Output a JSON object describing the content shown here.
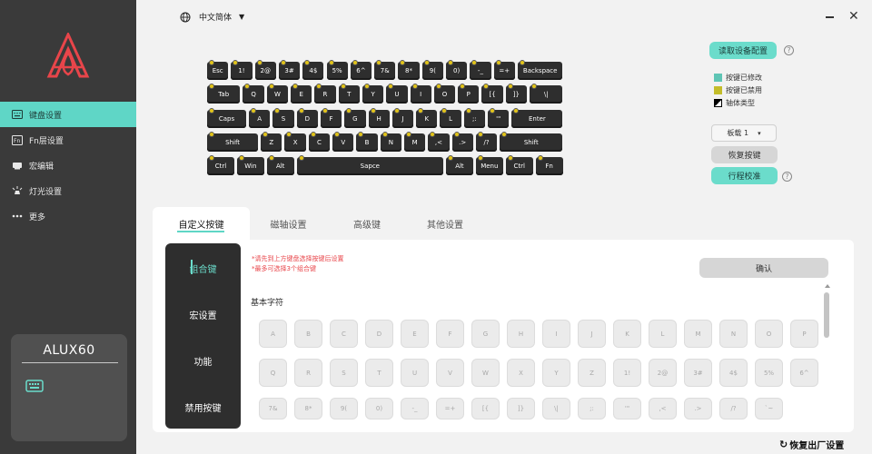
{
  "app": {
    "language": "中文简体",
    "device_name": "ALUX60"
  },
  "sidebar": {
    "items": [
      {
        "label": "键盘设置",
        "icon": "keyboard-icon",
        "active": true
      },
      {
        "label": "Fn层设置",
        "icon": "fn-icon",
        "active": false
      },
      {
        "label": "宏编辑",
        "icon": "macro-icon",
        "active": false
      },
      {
        "label": "灯光设置",
        "icon": "light-icon",
        "active": false
      },
      {
        "label": "更多",
        "icon": "more-icon",
        "active": false
      }
    ]
  },
  "controls": {
    "read_config": "读取设备配置",
    "legend": [
      {
        "label": "按键已修改",
        "color": "#5fc5b5"
      },
      {
        "label": "按键已禁用",
        "color": "#c3bd2a"
      },
      {
        "label": "轴体类型",
        "color": "#000000"
      }
    ],
    "profile_select": "板载 1",
    "restore_keys": "恢复按键",
    "travel_calibrate": "行程校准",
    "help": "?"
  },
  "keyboard": {
    "rows": [
      [
        "Esc",
        "1!",
        "2@",
        "3#",
        "4$",
        "5%",
        "6^",
        "7&",
        "8*",
        "9(",
        "0)",
        "-_",
        "=+",
        "Backspace"
      ],
      [
        "Tab",
        "Q",
        "W",
        "E",
        "R",
        "T",
        "Y",
        "U",
        "I",
        "O",
        "P",
        "[{",
        "]}",
        "\\|"
      ],
      [
        "Caps",
        "A",
        "S",
        "D",
        "F",
        "G",
        "H",
        "J",
        "K",
        "L",
        ";:",
        "'\"",
        "Enter"
      ],
      [
        "Shift",
        "Z",
        "X",
        "C",
        "V",
        "B",
        "N",
        "M",
        ",<",
        ".>",
        "/?",
        "Shift"
      ],
      [
        "Ctrl",
        "Win",
        "Alt",
        "Sapce",
        "Alt",
        "Menu",
        "Ctrl",
        "Fn"
      ]
    ]
  },
  "tabs": [
    "自定义按键",
    "磁轴设置",
    "高级键",
    "其他设置"
  ],
  "panel": {
    "subnav": [
      "组合键",
      "宏设置",
      "功能",
      "禁用按键"
    ],
    "hint_lines": [
      "*请先到上方键盘选择按键后设置",
      "*最多可选择3个组合键"
    ],
    "confirm": "确认",
    "section_title": "基本字符",
    "char_rows": [
      [
        "A",
        "B",
        "C",
        "D",
        "E",
        "F",
        "G",
        "H",
        "I",
        "J",
        "K",
        "L",
        "M",
        "N",
        "O",
        "P"
      ],
      [
        "Q",
        "R",
        "S",
        "T",
        "U",
        "V",
        "W",
        "X",
        "Y",
        "Z",
        "1!",
        "2@",
        "3#",
        "4$",
        "5%",
        "6^"
      ],
      [
        "7&",
        "8*",
        "9(",
        "0)",
        "-_",
        "=+",
        "[{",
        "]}",
        "\\|",
        ";:",
        "'\"",
        ",<",
        ".>",
        "/?",
        "`~"
      ]
    ]
  },
  "footer": {
    "factory_reset": "恢复出厂设置"
  }
}
